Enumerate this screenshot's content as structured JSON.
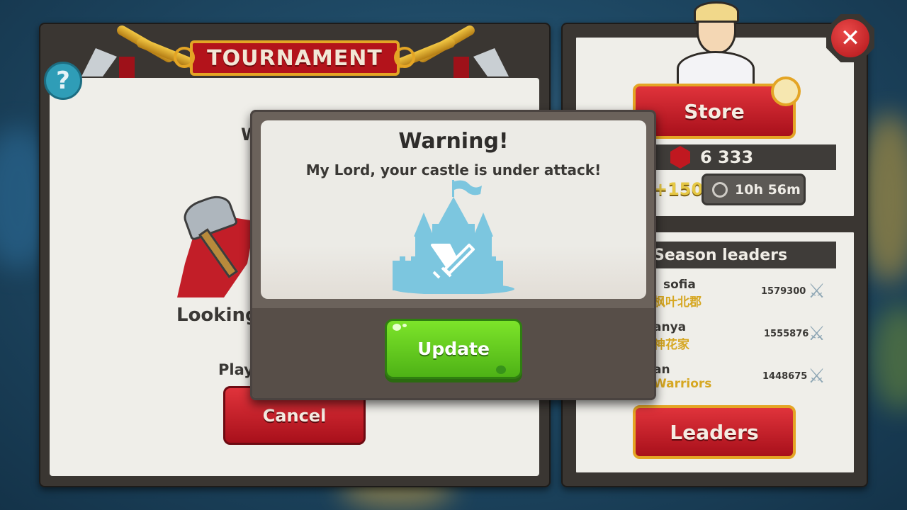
{
  "tournament": {
    "title": "TOURNAMENT",
    "help_symbol": "?",
    "partial_w": "W",
    "looking_label": "Looking",
    "play_label": "Play",
    "cancel_label": "Cancel"
  },
  "store_panel": {
    "store_label": "Store",
    "gems_value": "6 333",
    "bonus_value": "+150",
    "timer_value": "10h 56m"
  },
  "leaders_panel": {
    "title": "Season leaders",
    "rows": [
      {
        "name": "sofia",
        "clan": "枫叶北郡",
        "score": "1579300"
      },
      {
        "name": "anya",
        "clan": "神花家",
        "score": "1555876"
      },
      {
        "name": "an",
        "clan": "Warriors",
        "score": "1448675"
      }
    ],
    "leaders_button": "Leaders"
  },
  "close_symbol": "✕",
  "dialog": {
    "title": "Warning!",
    "message": "My Lord, your castle is under attack!",
    "button_label": "Update"
  },
  "colors": {
    "accent_green": "#5cc41c",
    "accent_red": "#c01820",
    "gold": "#e4a525",
    "castle_blue": "#7cc6df"
  }
}
